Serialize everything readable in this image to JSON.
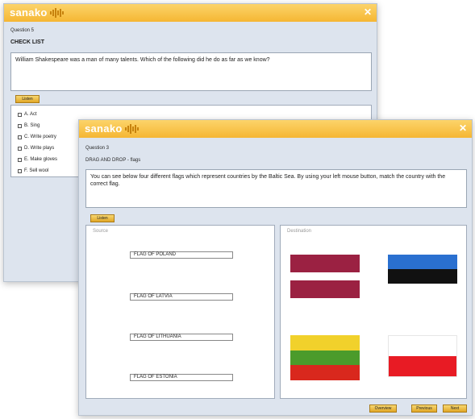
{
  "back_window": {
    "logo": "sanako",
    "question_number": "Question 5",
    "question_type": "CHECK LIST",
    "question_text": "William Shakespeare was a man of many talents. Which of the following did he do as far as we know?",
    "listen_button": "Listen",
    "options": [
      "A. Act",
      "B. Sing",
      "C. Write poetry",
      "D. Write plays",
      "E. Make gloves",
      "F. Sell wool"
    ]
  },
  "front_window": {
    "logo": "sanako",
    "question_number": "Question 3",
    "question_type": "DRAG AND DROP - flags",
    "question_text": "You can see below four different flags which represent countries by the Baltic Sea. By using your left mouse button, match the country with the correct flag.",
    "listen_button": "Listen",
    "source_label": "Source",
    "destination_label": "Destination",
    "source_items": [
      "FLAG OF POLAND",
      "FLAG OF LATVIA",
      "FLAG OF LITHUANIA",
      "FLAG OF ESTONIA"
    ],
    "buttons": {
      "b1": "Overview",
      "b2": "Previous",
      "b3": "Next"
    },
    "flags": [
      {
        "name": "latvia-flag",
        "colors": [
          "#9b2142",
          "#ffffff",
          "#9b2142"
        ],
        "ratio": [
          2,
          1,
          2
        ]
      },
      {
        "name": "estonia-flag",
        "colors": [
          "#2a70d0",
          "#111111",
          "#ffffff"
        ],
        "ratio": [
          1,
          1,
          1
        ]
      },
      {
        "name": "lithuania-flag",
        "colors": [
          "#f1d12b",
          "#4b9b2b",
          "#d9281d"
        ],
        "ratio": [
          1,
          1,
          1
        ]
      },
      {
        "name": "poland-flag",
        "colors": [
          "#ffffff",
          "#e81b24"
        ],
        "ratio": [
          1,
          1
        ]
      }
    ]
  }
}
